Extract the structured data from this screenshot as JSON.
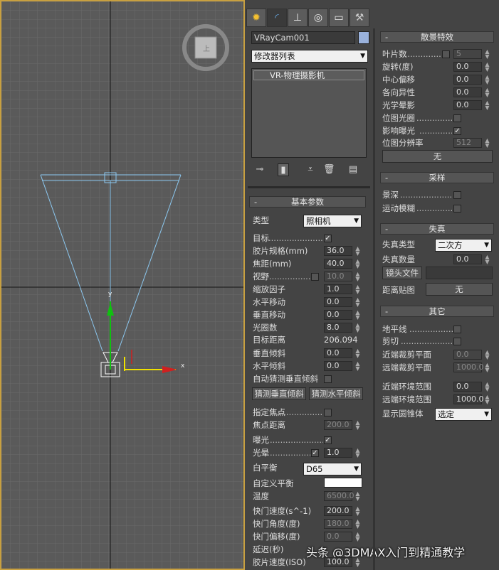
{
  "viewport": {
    "axis_x_label": "x",
    "axis_y_label": "y"
  },
  "command_panel": {
    "tabs": [
      {
        "name": "create-tab",
        "icon": "sun-icon",
        "glyph": "✹"
      },
      {
        "name": "modify-tab",
        "icon": "modify-arc-icon",
        "glyph": "◜"
      },
      {
        "name": "hierarchy-tab",
        "icon": "hierarchy-icon",
        "glyph": "⊥"
      },
      {
        "name": "motion-tab",
        "icon": "motion-icon",
        "glyph": "◎"
      },
      {
        "name": "display-tab",
        "icon": "display-icon",
        "glyph": "▭"
      },
      {
        "name": "utilities-tab",
        "icon": "hammer-icon",
        "glyph": "⚒"
      }
    ],
    "object_name": "VRayCam001",
    "object_color": "#9ab2dc",
    "modifier_list": "修改器列表",
    "stack_item": "VR-物理摄影机"
  },
  "basic_params": {
    "title": "基本参数",
    "type_label": "类型",
    "type_value": "照相机",
    "target_label": "目标",
    "target_checked": "✓",
    "film_gate_label": "胶片规格(mm)",
    "film_gate": "36.0",
    "focal_label": "焦距(mm)",
    "focal": "40.0",
    "fov_label": "视野",
    "fov": "10.0",
    "zoom_label": "缩放因子",
    "zoom": "1.0",
    "hshift_label": "水平移动",
    "hshift": "0.0",
    "vshift_label": "垂直移动",
    "vshift": "0.0",
    "fnumber_label": "光圈数",
    "fnumber": "8.0",
    "target_dist_label": "目标距离",
    "target_dist": "206.094",
    "vtilt_label": "垂直倾斜",
    "vtilt": "0.0",
    "htilt_label": "水平倾斜",
    "htilt": "0.0",
    "auto_vtilt_label": "自动猜测垂直倾斜",
    "guess_v_button": "猜测垂直倾斜",
    "guess_h_button": "猜测水平倾斜",
    "spec_focus_label": "指定焦点",
    "focus_dist_label": "焦点距离",
    "focus_dist": "200.0",
    "exposure_label": "曝光",
    "exposure_checked": "✓",
    "vignetting_label": "光晕",
    "vignetting_checked": "✓",
    "vignetting": "1.0",
    "wb_label": "白平衡",
    "wb_value": "D65",
    "custom_wb_label": "自定义平衡",
    "custom_wb_color": "#ffffff",
    "temp_label": "温度",
    "temp": "6500.0",
    "shutter_label": "快门速度(s^-1)",
    "shutter": "200.0",
    "shutter_angle_label": "快门角度(度)",
    "shutter_angle": "180.0",
    "shutter_offset_label": "快门偏移(度)",
    "shutter_offset": "0.0",
    "latency_label": "延迟(秒)",
    "iso_label": "胶片速度(ISO)",
    "iso": "100.0"
  },
  "bokeh": {
    "title": "散景特效",
    "blades_label": "叶片数",
    "blades": "5",
    "rotation_label": "旋转(度)",
    "rotation": "0.0",
    "center_bias_label": "中心偏移",
    "center_bias": "0.0",
    "anisotropy_label": "各向异性",
    "anisotropy": "0.0",
    "optical_vig_label": "光学晕影",
    "optical_vig": "0.0",
    "bitmap_aperture_label": "位图光圈",
    "affect_exposure_label": "影响曝光",
    "affect_exposure_checked": "✓",
    "bitmap_res_label": "位图分辨率",
    "bitmap_res": "512",
    "none_button": "无"
  },
  "sampling": {
    "title": "采样",
    "dof_label": "景深",
    "motion_blur_label": "运动模糊"
  },
  "distortion": {
    "title": "失真",
    "type_label": "失真类型",
    "type_value": "二次方",
    "amount_label": "失真数量",
    "amount": "0.0",
    "lens_file_button": "镜头文件",
    "dist_map_label": "距离贴图",
    "map_button": "无"
  },
  "misc": {
    "title": "其它",
    "horizon_label": "地平线",
    "clipping_label": "剪切",
    "near_clip_label": "近端裁剪平面",
    "near_clip": "0.0",
    "far_clip_label": "远端裁剪平面",
    "far_clip": "1000.0",
    "near_env_label": "近端环境范围",
    "near_env": "0.0",
    "far_env_label": "远端环境范围",
    "far_env": "1000.0",
    "cone_label": "显示圆锥体",
    "cone_value": "选定"
  },
  "watermark": "头条 @3DMAX入门到精通教学"
}
